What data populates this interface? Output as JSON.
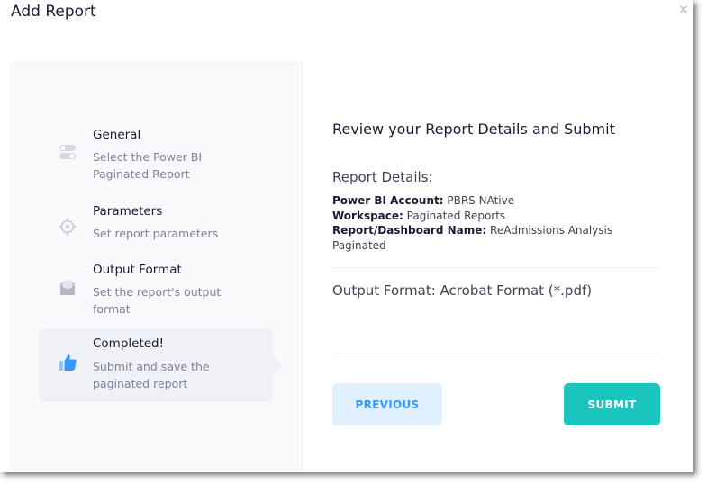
{
  "dialog": {
    "title": "Add Report",
    "close_icon": "×"
  },
  "steps": [
    {
      "icon": "toggle-icon",
      "title": "General",
      "desc": "Select the Power BI Paginated Report",
      "active": false
    },
    {
      "icon": "target-icon",
      "title": "Parameters",
      "desc": "Set report parameters",
      "active": false
    },
    {
      "icon": "envelope-icon",
      "title": "Output Format",
      "desc": "Set the report's output format",
      "active": false
    },
    {
      "icon": "thumbs-up-icon",
      "title": "Completed!",
      "desc": "Submit and save the paginated report",
      "active": true
    }
  ],
  "review": {
    "heading": "Review your Report Details and Submit",
    "details_heading": "Report Details:",
    "account_label": "Power BI Account:",
    "account_value": "PBRS NAtive",
    "workspace_label": "Workspace:",
    "workspace_value": "Paginated Reports",
    "report_label": "Report/Dashboard Name:",
    "report_value": "ReAdmissions Analysis Paginated",
    "output_format": "Output Format: Acrobat Format (*.pdf)"
  },
  "buttons": {
    "previous": "PREVIOUS",
    "submit": "SUBMIT"
  },
  "colors": {
    "accent": "#3699ff",
    "submit": "#1bc5bd",
    "active_icon": "#3699ff",
    "inactive_icon": "#b5b5c3"
  }
}
